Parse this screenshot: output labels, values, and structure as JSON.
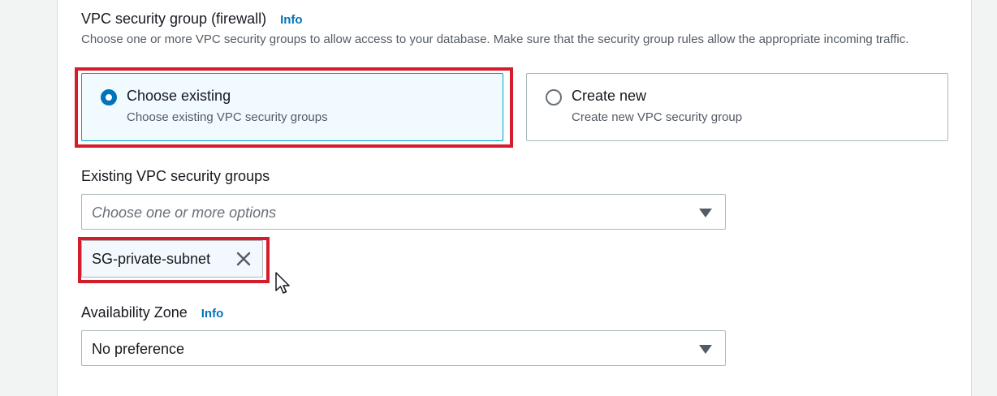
{
  "vpc_security_group": {
    "label": "VPC security group (firewall)",
    "info": "Info",
    "description": "Choose one or more VPC security groups to allow access to your database. Make sure that the security group rules allow the appropriate incoming traffic.",
    "options": [
      {
        "title": "Choose existing",
        "subtitle": "Choose existing VPC security groups",
        "selected": true
      },
      {
        "title": "Create new",
        "subtitle": "Create new VPC security group",
        "selected": false
      }
    ]
  },
  "existing_groups": {
    "label": "Existing VPC security groups",
    "placeholder": "Choose one or more options",
    "selected_tokens": [
      "SG-private-subnet"
    ]
  },
  "availability_zone": {
    "label": "Availability Zone",
    "info": "Info",
    "value": "No preference"
  },
  "colors": {
    "highlight": "#d51c2a",
    "link": "#0073bb",
    "selected_tile_bg": "#f1faff"
  }
}
